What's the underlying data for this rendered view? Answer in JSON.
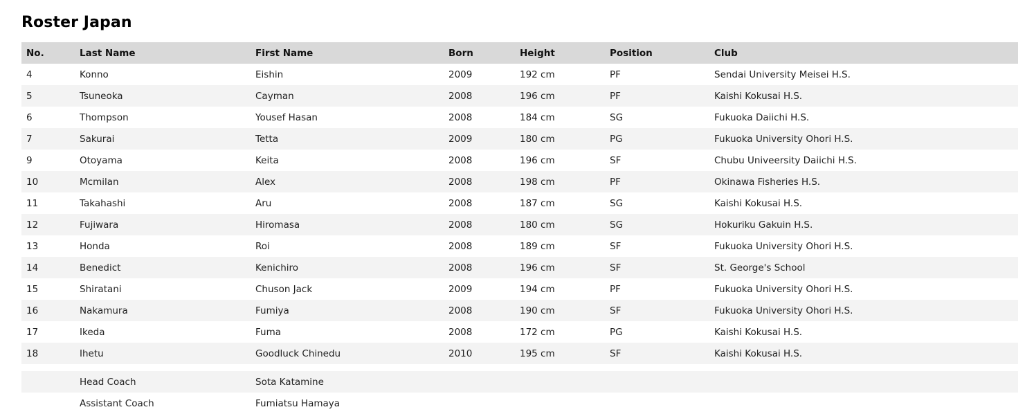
{
  "title": "Roster Japan",
  "columns": [
    "No.",
    "Last Name",
    "First Name",
    "Born",
    "Height",
    "Position",
    "Club"
  ],
  "players": [
    {
      "no": "4",
      "last": "Konno",
      "first": "Eishin",
      "born": "2009",
      "height": "192 cm",
      "position": "PF",
      "club": "Sendai University Meisei H.S."
    },
    {
      "no": "5",
      "last": "Tsuneoka",
      "first": "Cayman",
      "born": "2008",
      "height": "196 cm",
      "position": "PF",
      "club": "Kaishi Kokusai H.S."
    },
    {
      "no": "6",
      "last": "Thompson",
      "first": "Yousef Hasan",
      "born": "2008",
      "height": "184 cm",
      "position": "SG",
      "club": "Fukuoka Daiichi H.S."
    },
    {
      "no": "7",
      "last": "Sakurai",
      "first": "Tetta",
      "born": "2009",
      "height": "180 cm",
      "position": "PG",
      "club": "Fukuoka University Ohori H.S."
    },
    {
      "no": "9",
      "last": "Otoyama",
      "first": "Keita",
      "born": "2008",
      "height": "196 cm",
      "position": "SF",
      "club": "Chubu Univeersity Daiichi H.S."
    },
    {
      "no": "10",
      "last": "Mcmilan",
      "first": "Alex",
      "born": "2008",
      "height": "198 cm",
      "position": "PF",
      "club": "Okinawa Fisheries H.S."
    },
    {
      "no": "11",
      "last": "Takahashi",
      "first": "Aru",
      "born": "2008",
      "height": "187 cm",
      "position": "SG",
      "club": "Kaishi Kokusai H.S."
    },
    {
      "no": "12",
      "last": "Fujiwara",
      "first": "Hiromasa",
      "born": "2008",
      "height": "180 cm",
      "position": "SG",
      "club": "Hokuriku Gakuin H.S."
    },
    {
      "no": "13",
      "last": "Honda",
      "first": "Roi",
      "born": "2008",
      "height": "189 cm",
      "position": "SF",
      "club": "Fukuoka University Ohori H.S."
    },
    {
      "no": "14",
      "last": "Benedict",
      "first": "Kenichiro",
      "born": "2008",
      "height": "196 cm",
      "position": "SF",
      "club": "St. George's School"
    },
    {
      "no": "15",
      "last": "Shiratani",
      "first": "Chuson Jack",
      "born": "2009",
      "height": "194 cm",
      "position": "PF",
      "club": "Fukuoka University Ohori H.S."
    },
    {
      "no": "16",
      "last": "Nakamura",
      "first": "Fumiya",
      "born": "2008",
      "height": "190 cm",
      "position": "SF",
      "club": "Fukuoka University Ohori H.S."
    },
    {
      "no": "17",
      "last": "Ikeda",
      "first": "Fuma",
      "born": "2008",
      "height": "172 cm",
      "position": "PG",
      "club": "Kaishi Kokusai H.S."
    },
    {
      "no": "18",
      "last": "Ihetu",
      "first": "Goodluck Chinedu",
      "born": "2010",
      "height": "195 cm",
      "position": "SF",
      "club": "Kaishi Kokusai H.S."
    }
  ],
  "staff": [
    {
      "role": "Head Coach",
      "name": "Sota Katamine"
    },
    {
      "role": "Assistant Coach",
      "name": "Fumiatsu Hamaya"
    }
  ]
}
